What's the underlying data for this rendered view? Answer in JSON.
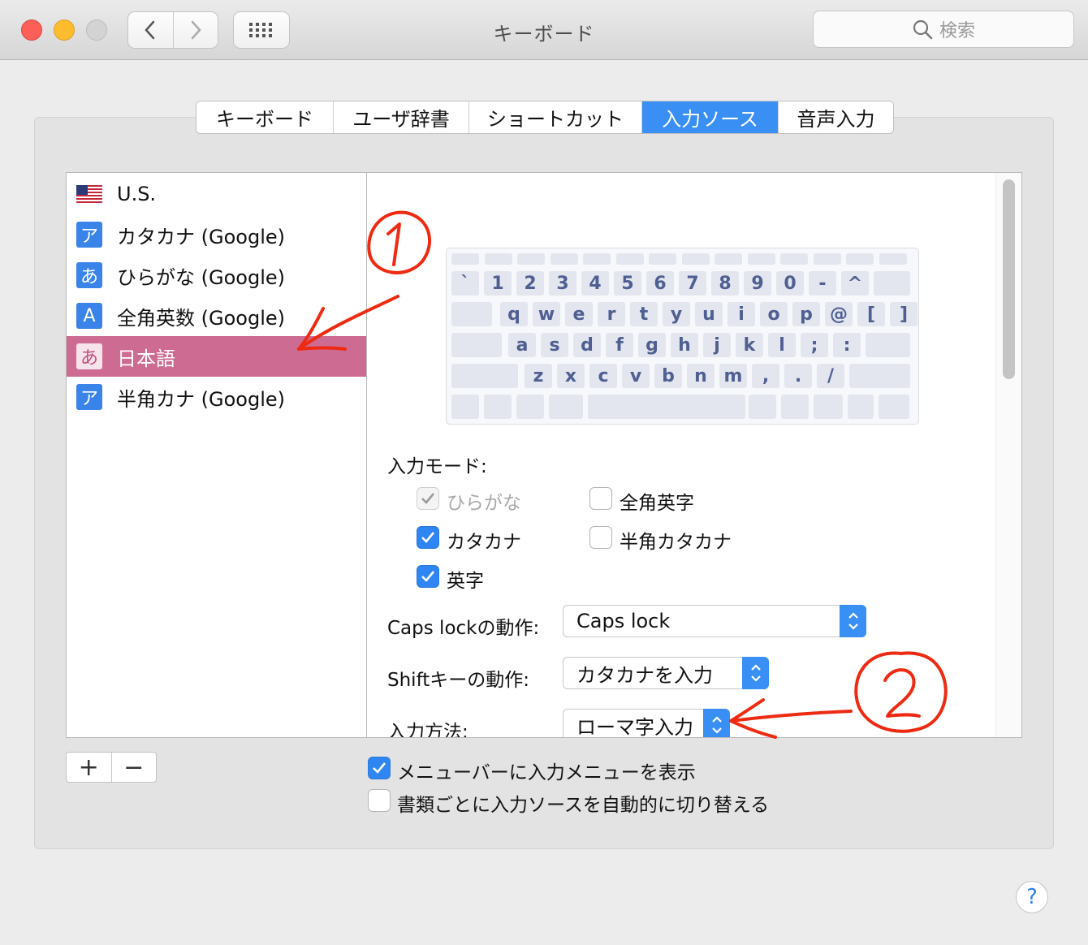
{
  "window": {
    "title": "キーボード"
  },
  "toolbar": {
    "search_placeholder": "検索"
  },
  "tabs": [
    {
      "label": "キーボード",
      "active": false
    },
    {
      "label": "ユーザ辞書",
      "active": false
    },
    {
      "label": "ショートカット",
      "active": false
    },
    {
      "label": "入力ソース",
      "active": true
    },
    {
      "label": "音声入力",
      "active": false
    }
  ],
  "sources": [
    {
      "icon": "us-flag-icon",
      "glyph": "",
      "label": "U.S.",
      "selected": false
    },
    {
      "icon": "katakana-icon",
      "glyph": "ア",
      "label": "カタカナ (Google)",
      "selected": false
    },
    {
      "icon": "hiragana-icon",
      "glyph": "あ",
      "label": "ひらがな (Google)",
      "selected": false
    },
    {
      "icon": "fullwidth-alpha-icon",
      "glyph": "A",
      "label": "全角英数 (Google)",
      "selected": false
    },
    {
      "icon": "hiragana-icon",
      "glyph": "あ",
      "label": "日本語",
      "selected": true
    },
    {
      "icon": "katakana-icon",
      "glyph": "ア",
      "label": "半角カナ (Google)",
      "selected": false
    }
  ],
  "keyboard_rows": [
    [
      "`",
      "1",
      "2",
      "3",
      "4",
      "5",
      "6",
      "7",
      "8",
      "9",
      "0",
      "-",
      "^"
    ],
    [
      "q",
      "w",
      "e",
      "r",
      "t",
      "y",
      "u",
      "i",
      "o",
      "p",
      "@",
      "[",
      "]"
    ],
    [
      "a",
      "s",
      "d",
      "f",
      "g",
      "h",
      "j",
      "k",
      "l",
      ";",
      ":"
    ],
    [
      "z",
      "x",
      "c",
      "v",
      "b",
      "n",
      "m",
      ",",
      ".",
      "/"
    ]
  ],
  "input_modes": {
    "label": "入力モード:",
    "items": [
      {
        "label": "ひらがな",
        "checked": true,
        "disabled": true
      },
      {
        "label": "全角英字",
        "checked": false,
        "disabled": false
      },
      {
        "label": "カタカナ",
        "checked": true,
        "disabled": false
      },
      {
        "label": "半角カタカナ",
        "checked": false,
        "disabled": false
      },
      {
        "label": "英字",
        "checked": true,
        "disabled": false
      }
    ]
  },
  "settings": {
    "caps_label": "Caps lockの動作:",
    "caps_value": "Caps lock",
    "shift_label": "Shiftキーの動作:",
    "shift_value": "カタカナを入力",
    "method_label": "入力方法:",
    "method_value": "ローマ字入力"
  },
  "bottom": {
    "add": "+",
    "remove": "−",
    "show_menu_label": "メニューバーに入力メニューを表示",
    "show_menu_checked": true,
    "auto_switch_label": "書類ごとに入力ソースを自動的に切り替える",
    "auto_switch_checked": false,
    "help": "?"
  },
  "colors": {
    "accent": "#3a8ff5",
    "selection": "#cd6b92",
    "annotation": "#ee2a12"
  }
}
